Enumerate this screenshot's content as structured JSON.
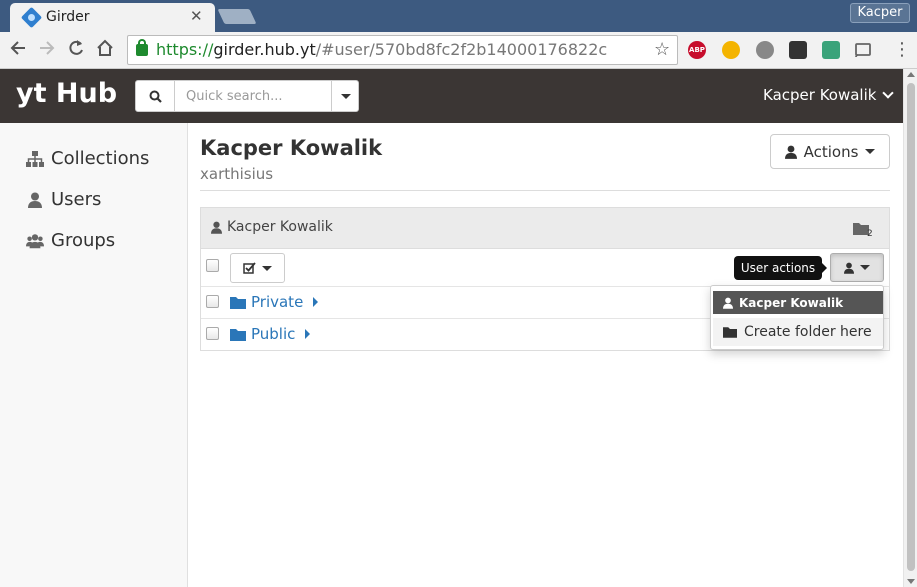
{
  "browser": {
    "tab_title": "Girder",
    "tab_close": "✕",
    "profile_name": "Kacper",
    "url_scheme": "https://",
    "url_host": "girder.hub.yt",
    "url_path": "/#user/570bd8fc2f2b14000176822c",
    "extensions": [
      {
        "name": "adblock-icon",
        "label": "ABP",
        "color": "#c70d2c"
      },
      {
        "name": "media-player-icon",
        "label": "",
        "color": "#f4b400"
      },
      {
        "name": "extension-icon",
        "label": "",
        "color": "#888888"
      },
      {
        "name": "tampermonkey-icon",
        "label": "",
        "color": "#333333"
      },
      {
        "name": "screenshot-icon",
        "label": "",
        "color": "#3aa37a"
      },
      {
        "name": "cast-icon",
        "label": "",
        "color": "#666666"
      }
    ]
  },
  "header": {
    "brand": "yt Hub",
    "search_placeholder": "Quick search...",
    "user_menu_label": "Kacper Kowalik"
  },
  "sidebar": {
    "items": [
      {
        "label": "Collections",
        "icon": "sitemap-icon"
      },
      {
        "label": "Users",
        "icon": "user-icon"
      },
      {
        "label": "Groups",
        "icon": "users-icon"
      }
    ]
  },
  "profile": {
    "full_name": "Kacper Kowalik",
    "login": "xarthisius",
    "actions_label": "Actions"
  },
  "browser_panel": {
    "title": "Kacper Kowalik",
    "folder_count": "2",
    "folders": [
      {
        "name": "Private"
      },
      {
        "name": "Public"
      }
    ]
  },
  "user_actions": {
    "tooltip": "User actions",
    "menu_header": "Kacper Kowalik",
    "menu_item": "Create folder here"
  },
  "colors": {
    "appbar": "#3b3634",
    "link": "#2a76b8",
    "tabstrip": "#3d5a80"
  }
}
